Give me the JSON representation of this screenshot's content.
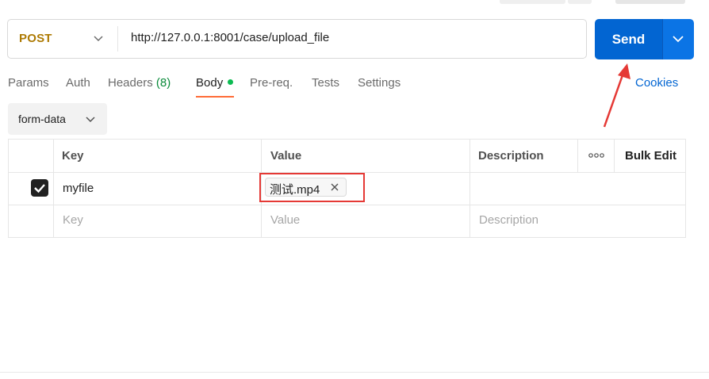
{
  "request": {
    "method": "POST",
    "url": "http://127.0.0.1:8001/case/upload_file",
    "send_label": "Send"
  },
  "tabs": {
    "params": "Params",
    "auth": "Auth",
    "headers": "Headers",
    "headers_count": "(8)",
    "body": "Body",
    "prereq": "Pre-req.",
    "tests": "Tests",
    "settings": "Settings",
    "cookies": "Cookies"
  },
  "body": {
    "mode": "form-data"
  },
  "table": {
    "headers": {
      "key": "Key",
      "value": "Value",
      "description": "Description",
      "bulk_edit": "Bulk Edit"
    },
    "rows": [
      {
        "checked": true,
        "key": "myfile",
        "file": "测试.mp4",
        "description": ""
      }
    ],
    "placeholders": {
      "key": "Key",
      "value": "Value",
      "description": "Description"
    }
  },
  "colors": {
    "method": "#ad7a03",
    "send": "#0265d2",
    "active_tab_underline": "#ff6c37",
    "body_dot": "#0cbb52",
    "annotation": "#e53935"
  }
}
